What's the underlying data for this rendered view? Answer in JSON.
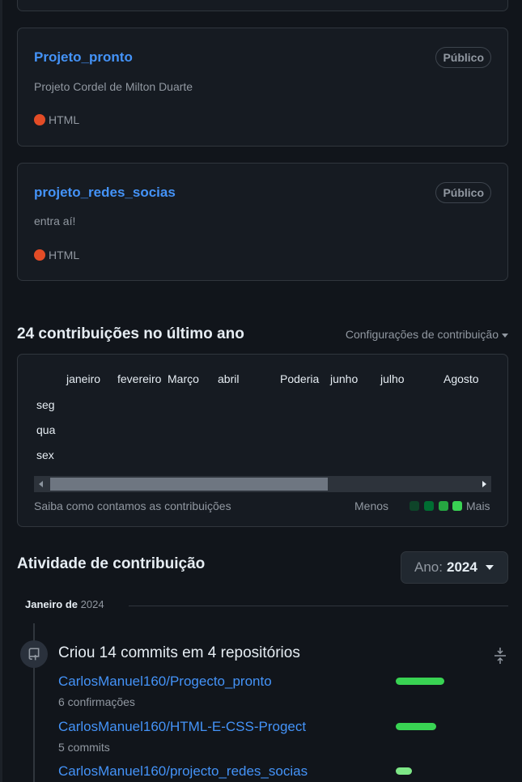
{
  "repos": [
    {
      "name": "Projeto_pronto",
      "badge": "Público",
      "description": "Projeto Cordel de Milton Duarte",
      "language": "HTML"
    },
    {
      "name": "projeto_redes_socias",
      "badge": "Público",
      "description": "entra aí!",
      "language": "HTML"
    }
  ],
  "colors": {
    "html_lang": "#e34c26",
    "link": "#4493f8",
    "legend": [
      "#0e4429",
      "#006d32",
      "#26a641",
      "#39d353"
    ]
  },
  "contributions": {
    "title": "24 contribuições no último ano",
    "settings": "Configurações de contribuição",
    "months": [
      "janeiro",
      "fevereiro",
      "Março",
      "abril",
      "Poderia",
      "junho",
      "julho",
      "Agosto"
    ],
    "days": [
      "seg",
      "qua",
      "sex"
    ],
    "learn_link": "Saiba como contamos as contribuições",
    "less": "Menos",
    "more": "Mais"
  },
  "activity": {
    "title": "Atividade de contribuição",
    "year_label": "Ano:",
    "year_value": "2024",
    "month_heading": "Janeiro de",
    "month_year": "2024",
    "summary": "Criou 14 commits em 4 repositórios",
    "items": [
      {
        "repo": "CarlosManuel160/Progecto_pronto",
        "count": "6 confirmações",
        "share": 1.0
      },
      {
        "repo": "CarlosManuel160/HTML-E-CSS-Progect",
        "count": "5 commits",
        "share": 0.83
      },
      {
        "repo": "CarlosManuel160/projecto_redes_socias",
        "count": "",
        "share": 0.33
      }
    ]
  }
}
